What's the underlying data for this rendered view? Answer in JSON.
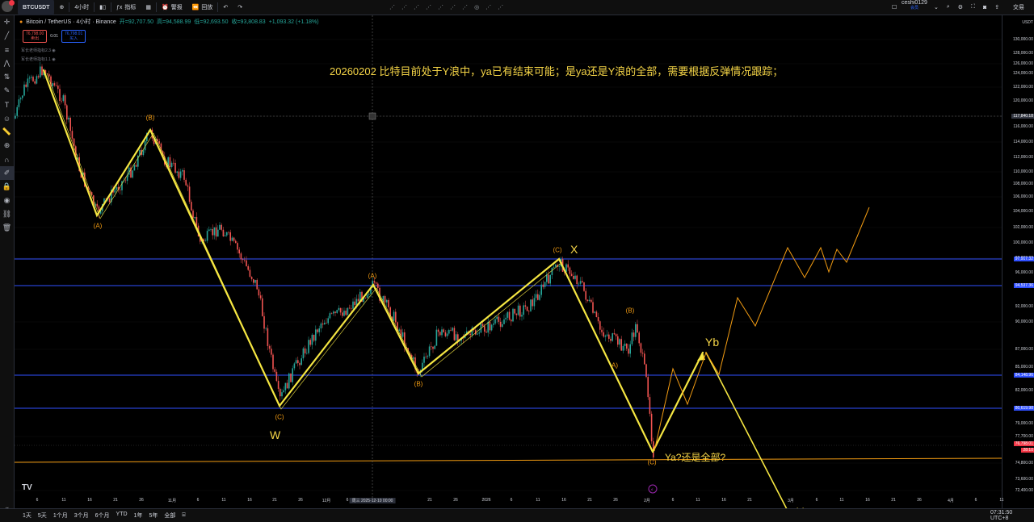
{
  "topbar": {
    "symbol": "BTCUSDT",
    "interval": "4小时",
    "indicators": "指标",
    "alert": "警报",
    "replay": "回放",
    "user": "ceshi0129",
    "user_sub": "会员",
    "trade": "交易"
  },
  "legend": {
    "title": "Bitcoin / TetherUS · 4小时 · Binance",
    "open": "开=92,707.50",
    "high": "高=94,588.99",
    "low": "低=92,693.50",
    "close": "收=93,808.83",
    "change": "+1,093.32 (+1.18%)"
  },
  "order": {
    "sell_price": "76,798.00",
    "sell_label": "卖出",
    "spread": "0.01",
    "buy_price": "76,798.01",
    "buy_label": "买入"
  },
  "indicators": [
    "军长老师指标2.3",
    "军长老师指标1.1"
  ],
  "annotation": "20260202 比特目前处于Y浪中，ya已有结束可能；是ya还是Y浪的全部，需要根据反弹情况跟踪；",
  "waves": {
    "W": "W",
    "X": "X",
    "Yb": "Yb",
    "Yc": "Yc",
    "Ya": "Ya?还是全部?",
    "A1": "(A)",
    "B1": "(B)",
    "C1": "(C)",
    "A2": "(A)",
    "B2": "(B)",
    "C2": "(C)",
    "A3": "A)",
    "B3": "(B)",
    "C3": "(C)"
  },
  "price_axis": {
    "currency": "USDT",
    "labels": [
      "130,000.00",
      "128,000.00",
      "126,000.00",
      "124,000.00",
      "122,000.00",
      "120,000.00",
      "116,000.00",
      "114,000.00",
      "112,000.00",
      "110,000.00",
      "108,000.00",
      "106,000.00",
      "104,000.00",
      "102,000.00",
      "100,000.00",
      "98,000.00",
      "96,000.00",
      "92,000.00",
      "90,000.00",
      "87,000.00",
      "85,000.00",
      "82,000.00",
      "79,000.00",
      "77,700.00",
      "74,800.00",
      "73,600.00",
      "72,400.00"
    ],
    "tags": {
      "crosshair": "117,840.18",
      "l1": "97,917.32",
      "l2": "94,537.36",
      "l3": "84,148.96",
      "l4": "80,619.98",
      "last": "76,798.01",
      "countdown": "28:10"
    }
  },
  "x_axis": {
    "labels": [
      "6",
      "11",
      "16",
      "21",
      "26",
      "11月",
      "6",
      "11",
      "16",
      "21",
      "26",
      "12月",
      "6",
      "21",
      "26",
      "2026",
      "6",
      "11",
      "16",
      "21",
      "26",
      "2月",
      "6",
      "11",
      "16",
      "21",
      "3月",
      "6",
      "11",
      "16",
      "21",
      "26",
      "4月",
      "6",
      "11"
    ],
    "crosshair": "周三 2025-12-10   00:00"
  },
  "bottombar": {
    "ranges": [
      "1天",
      "5天",
      "1个月",
      "3个月",
      "6个月",
      "YTD",
      "1年",
      "5年",
      "全部"
    ],
    "time": "07:31:50 UTC+8"
  },
  "colors": {
    "accent": "#f5d547",
    "orange": "#f39c12",
    "level": "#2f4fff",
    "up": "#26a69a",
    "down": "#ef5350"
  }
}
